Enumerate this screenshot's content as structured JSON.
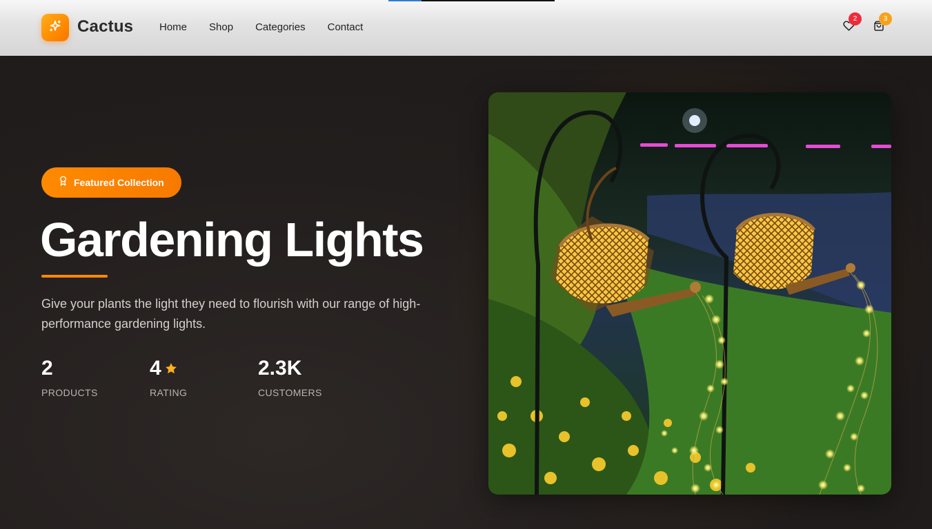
{
  "colors": {
    "accent": "#ff8a00",
    "hero_background": "#221e1d",
    "header_background": "#e2e2e2",
    "badge_wishlist": "#ee2b3b",
    "badge_cart": "#f7a21b",
    "star": "#ffb020"
  },
  "header": {
    "logo_icon": "sparkle-icon",
    "brand": "Cactus",
    "nav": [
      {
        "label": "Home"
      },
      {
        "label": "Shop"
      },
      {
        "label": "Categories"
      },
      {
        "label": "Contact"
      }
    ],
    "wishlist": {
      "icon": "heart-icon",
      "count": "2"
    },
    "cart": {
      "icon": "shopping-bag-icon",
      "count": "3"
    }
  },
  "hero": {
    "badge": {
      "icon": "award-icon",
      "label": "Featured Collection"
    },
    "title": "Gardening Lights",
    "description": "Give your plants the light they need to flourish with our range of high-performance gardening lights.",
    "stats": [
      {
        "value": "2",
        "label": "PRODUCTS"
      },
      {
        "value": "4",
        "label": "RATING",
        "icon": "star-icon"
      },
      {
        "value": "2.3K",
        "label": "CUSTOMERS"
      }
    ],
    "image": {
      "alt": "Solar watering can garden lights"
    }
  }
}
